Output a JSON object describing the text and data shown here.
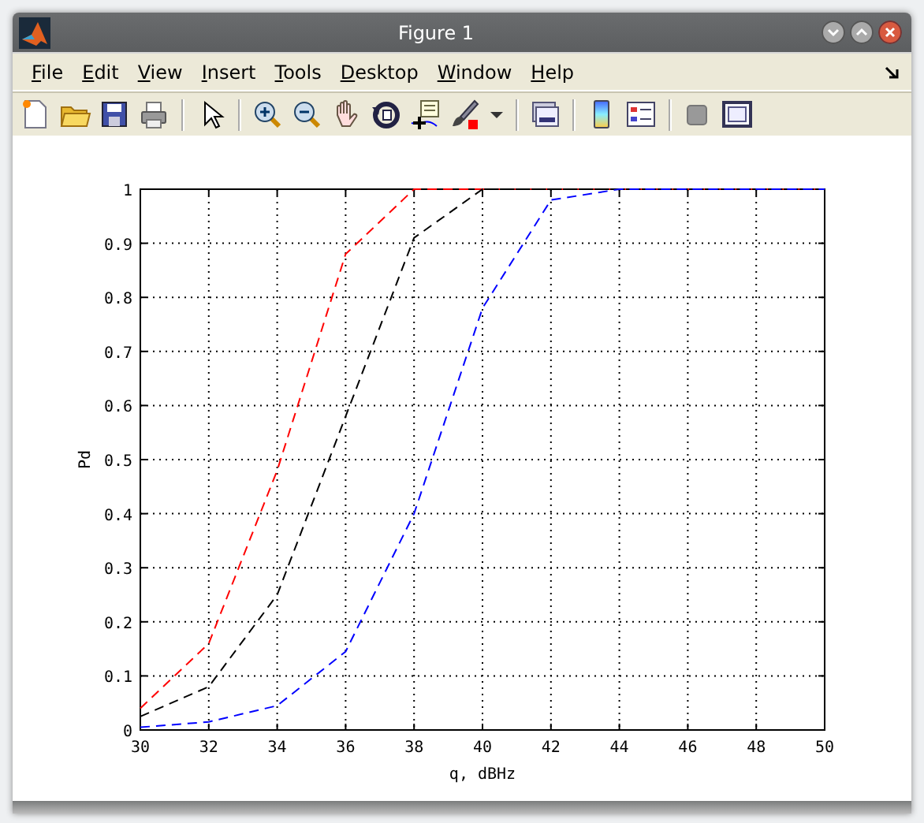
{
  "window": {
    "title": "Figure 1"
  },
  "menu": [
    {
      "label": "File"
    },
    {
      "label": "Edit"
    },
    {
      "label": "View"
    },
    {
      "label": "Insert"
    },
    {
      "label": "Tools"
    },
    {
      "label": "Desktop"
    },
    {
      "label": "Window"
    },
    {
      "label": "Help"
    }
  ],
  "figure": {
    "chart_data": {
      "type": "line",
      "xlabel": "q, dBHz",
      "ylabel": "Pd",
      "x": [
        30,
        32,
        34,
        36,
        38,
        40,
        42,
        44,
        46,
        48,
        50
      ],
      "xlim": [
        30,
        50
      ],
      "ylim": [
        0,
        1
      ],
      "xticks": [
        30,
        32,
        34,
        36,
        38,
        40,
        42,
        44,
        46,
        48,
        50
      ],
      "yticks": [
        0,
        0.1,
        0.2,
        0.3,
        0.4,
        0.5,
        0.6,
        0.7,
        0.8,
        0.9,
        1
      ],
      "grid": true,
      "series": [
        {
          "color": "#ff0000",
          "line_style": "dashed",
          "values": [
            0.04,
            0.16,
            0.48,
            0.88,
            1,
            1,
            1,
            1,
            1,
            1,
            1
          ]
        },
        {
          "color": "#000000",
          "line_style": "dashed",
          "values": [
            0.025,
            0.08,
            0.25,
            0.58,
            0.91,
            1,
            1,
            1,
            1,
            1,
            1
          ]
        },
        {
          "color": "#0000ff",
          "line_style": "dashed",
          "values": [
            0.005,
            0.015,
            0.045,
            0.145,
            0.4,
            0.78,
            0.98,
            1,
            1,
            1,
            1
          ]
        }
      ]
    }
  }
}
